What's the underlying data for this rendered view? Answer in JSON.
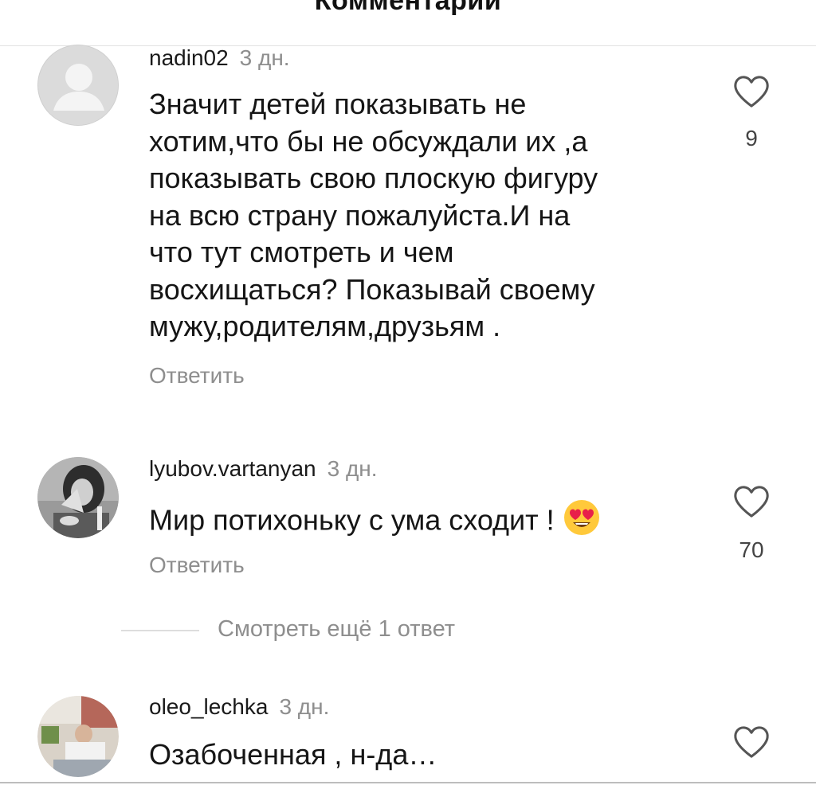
{
  "header": {
    "title": "Комментарии"
  },
  "comments": [
    {
      "username": "nadin02",
      "time": "3 дн.",
      "text_lines": [
        "Значит детей показывать не",
        "хотим,что бы не обсуждали их ,а",
        "показывать свою плоскую фигуру",
        "на всю страну пожалуйста.И  на",
        "что тут смотреть и чем",
        "восхищаться? Показывай своему",
        "мужу,родителям,друзьям ."
      ],
      "reply_label": "Ответить",
      "likes": "9",
      "avatar": "default-avatar"
    },
    {
      "username": "lyubov.vartanyan",
      "time": "3 дн.",
      "text": "Мир потихоньку с ума сходит !",
      "emoji": "heart-eyes-emoji",
      "reply_label": "Ответить",
      "likes": "70",
      "avatar": "photo-avatar"
    },
    {
      "username": "oleo_lechka",
      "time": "3 дн.",
      "text": "Озабоченная , н-да…",
      "avatar": "photo-avatar"
    }
  ],
  "view_more": {
    "label": "Смотреть ещё 1 ответ"
  },
  "icons": {
    "like": "heart-outline-icon"
  },
  "colors": {
    "secondary_text": "#8e8e8e",
    "primary_text": "#151515",
    "divider": "#dddddd"
  }
}
